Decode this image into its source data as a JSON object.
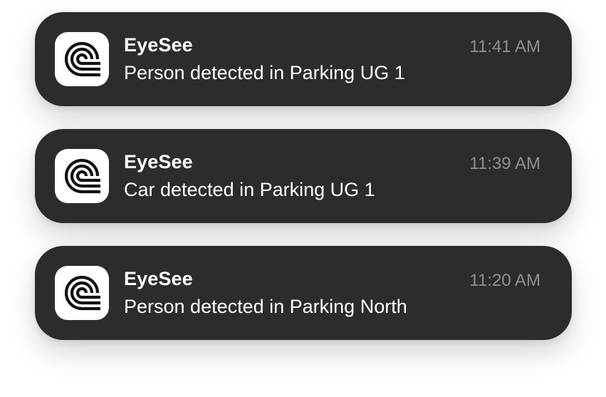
{
  "notifications": [
    {
      "app_name": "EyeSee",
      "message": "Person detected in Parking UG 1",
      "time": "11:41 AM",
      "icon": "eyesee-logo-icon"
    },
    {
      "app_name": "EyeSee",
      "message": "Car detected in Parking UG 1",
      "time": "11:39 AM",
      "icon": "eyesee-logo-icon"
    },
    {
      "app_name": "EyeSee",
      "message": "Person detected in Parking North",
      "time": "11:20 AM",
      "icon": "eyesee-logo-icon"
    }
  ],
  "colors": {
    "card_background": "#2c2c2e",
    "primary_text": "#ffffff",
    "secondary_text": "#8e8e93",
    "icon_background": "#ffffff",
    "icon_foreground": "#111111"
  }
}
